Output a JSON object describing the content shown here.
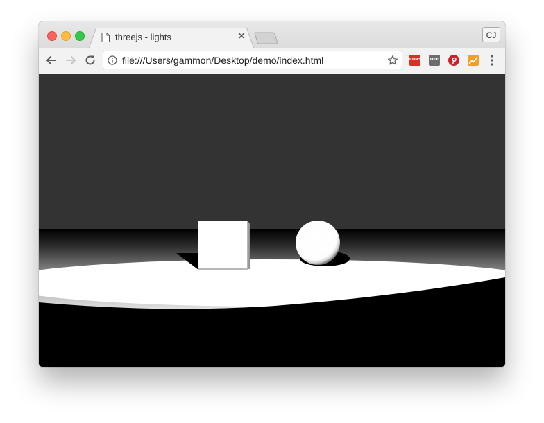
{
  "browser": {
    "tab": {
      "title": "threejs - lights",
      "favicon": "page-icon",
      "close_icon": "close-icon"
    },
    "new_tab_icon": "new-tab-icon",
    "profile": {
      "label": "CJ"
    },
    "toolbar": {
      "back_icon": "arrow-left-icon",
      "forward_icon": "arrow-right-icon",
      "reload_icon": "reload-icon",
      "url": "file:///Users/gammon/Desktop/demo/index.html",
      "info_icon": "info-icon",
      "bookmark_icon": "star-icon",
      "menu_icon": "vertical-dots-icon"
    },
    "extensions": [
      {
        "name": "cors-extension",
        "label": "CORS",
        "color": "#d93025"
      },
      {
        "name": "off-extension",
        "label": "OFF",
        "color": "#6d6d6d"
      },
      {
        "name": "pinterest-extension",
        "label": "",
        "color": "#cb2027"
      },
      {
        "name": "analytics-extension",
        "label": "",
        "color": "#f4a024"
      }
    ]
  },
  "scene": {
    "sky_color": "#333333",
    "floor_shadow_color": "#000000",
    "light_color": "#ffffff",
    "objects": [
      "cube",
      "sphere"
    ]
  }
}
